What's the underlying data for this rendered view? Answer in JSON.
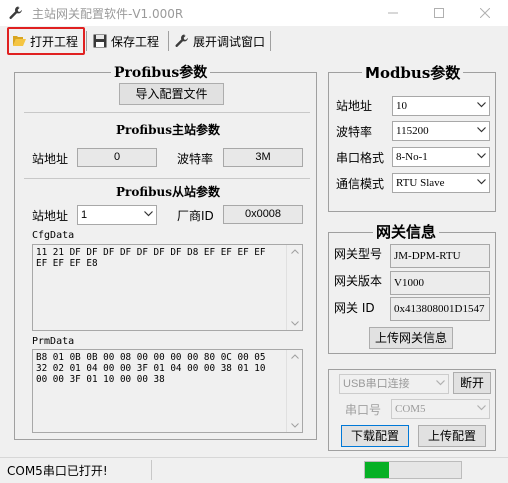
{
  "window": {
    "title": "主站网关配置软件-V1.000R"
  },
  "toolbar": {
    "open_project": "打开工程",
    "save_project": "保存工程",
    "expand_debug": "展开调试窗口"
  },
  "profibus": {
    "legend": "Profibus参数",
    "import_button": "导入配置文件",
    "master_section": "Profibus主站参数",
    "station_addr_label": "站地址",
    "station_addr_value": "0",
    "baud_label": "波特率",
    "baud_value": "3M",
    "slave_section": "Profibus从站参数",
    "slave_addr_label": "站地址",
    "slave_addr_value": "1",
    "vendor_id_label": "厂商ID",
    "vendor_id_value": "0x0008",
    "cfg_label": "CfgData",
    "cfg_value": "11 21 DF DF DF DF DF DF DF D8 EF EF EF EF\nEF EF EF E8",
    "prm_label": "PrmData",
    "prm_value": "B8 01 0B 0B 00 08 00 00 00 00 80 0C 00 05\n32 02 01 04 00 00 3F 01 04 00 00 38 01 10\n00 00 3F 01 10 00 00 38"
  },
  "modbus": {
    "legend_m": "M",
    "legend_rest": "odbus参数",
    "station_label": "站地址",
    "station_value": "10",
    "baud_label": "波特率",
    "baud_value": "115200",
    "serial_fmt_label": "串口格式",
    "serial_fmt_value": "8-No-1",
    "comm_mode_label": "通信模式",
    "comm_mode_value": "RTU Slave"
  },
  "gateway": {
    "legend": "网关信息",
    "model_label": "网关型号",
    "model_value": "JM-DPM-RTU",
    "version_label": "网关版本",
    "version_value": "V1000",
    "id_label": "网关 ID",
    "id_value": "0x413808001D1547",
    "upload_info_button": "上传网关信息"
  },
  "connection": {
    "usb_value": "USB串口连接",
    "disconnect_button": "断开",
    "port_label": "串口号",
    "port_value": "COM5",
    "download_button": "下载配置",
    "upload_button": "上传配置"
  },
  "status": {
    "message": "COM5串口已打开!",
    "progress_percent": 25
  },
  "colors": {
    "highlight": "#e02020",
    "progress": "#06b025",
    "focus": "#0078d7"
  }
}
